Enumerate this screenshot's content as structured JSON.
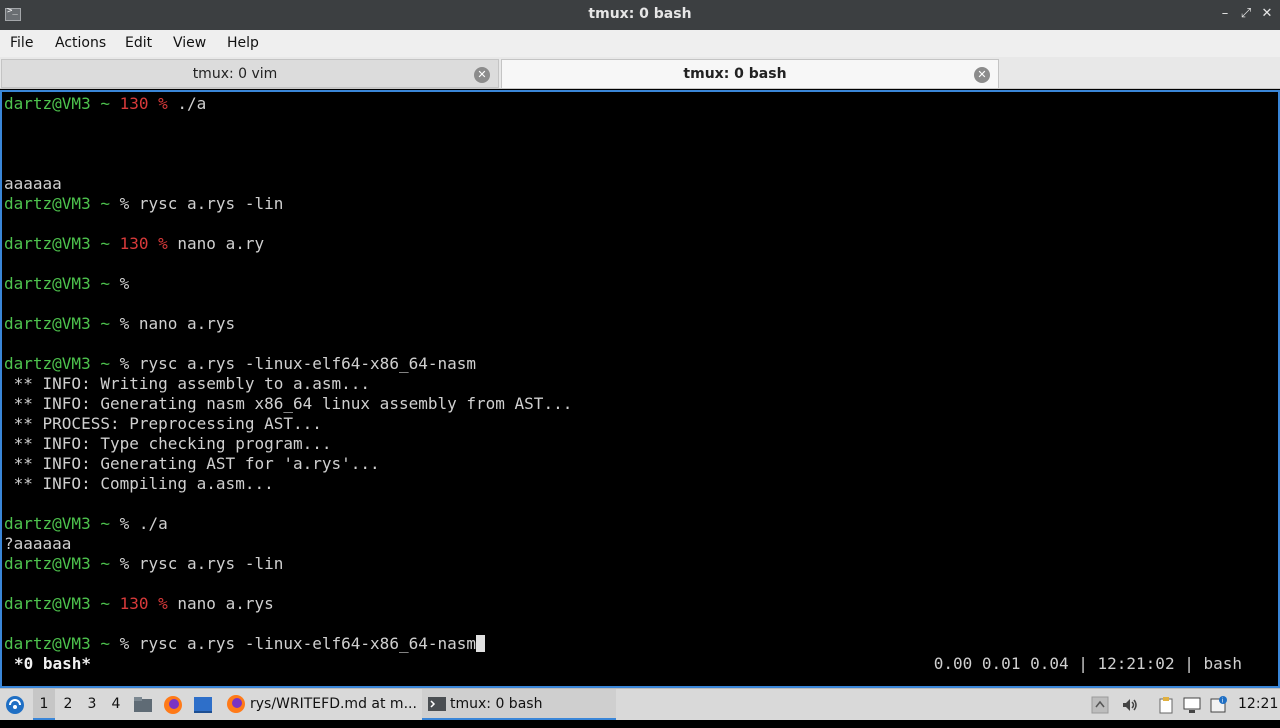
{
  "window": {
    "title": "tmux: 0 bash"
  },
  "menu": [
    "File",
    "Actions",
    "Edit",
    "View",
    "Help"
  ],
  "tabs": [
    {
      "label": "tmux: 0 vim",
      "active": false
    },
    {
      "label": "tmux: 0 bash",
      "active": true
    }
  ],
  "terminal": {
    "lines": [
      {
        "user": "dartz@VM3 ~ ",
        "code": "130",
        "prompt": " % ",
        "cmd": "./a"
      },
      {
        "text": ""
      },
      {
        "text": ""
      },
      {
        "text": ""
      },
      {
        "text": "aaaaaa"
      },
      {
        "user": "dartz@VM3 ~ ",
        "prompt": "% ",
        "cmd": "rysc a.rys -lin"
      },
      {
        "text": ""
      },
      {
        "user": "dartz@VM3 ~ ",
        "code": "130",
        "prompt": " % ",
        "cmd": "nano a.ry"
      },
      {
        "text": ""
      },
      {
        "user": "dartz@VM3 ~ ",
        "prompt": "% ",
        "cmd": ""
      },
      {
        "text": ""
      },
      {
        "user": "dartz@VM3 ~ ",
        "prompt": "% ",
        "cmd": "nano a.rys"
      },
      {
        "text": ""
      },
      {
        "user": "dartz@VM3 ~ ",
        "prompt": "% ",
        "cmd": "rysc a.rys -linux-elf64-x86_64-nasm"
      },
      {
        "text": " ** INFO: Writing assembly to a.asm..."
      },
      {
        "text": " ** INFO: Generating nasm x86_64 linux assembly from AST..."
      },
      {
        "text": " ** PROCESS: Preprocessing AST..."
      },
      {
        "text": " ** INFO: Type checking program..."
      },
      {
        "text": " ** INFO: Generating AST for 'a.rys'..."
      },
      {
        "text": " ** INFO: Compiling a.asm..."
      },
      {
        "text": ""
      },
      {
        "user": "dartz@VM3 ~ ",
        "prompt": "% ",
        "cmd": "./a"
      },
      {
        "text": "?aaaaaa"
      },
      {
        "user": "dartz@VM3 ~ ",
        "prompt": "% ",
        "cmd": "rysc a.rys -lin"
      },
      {
        "text": ""
      },
      {
        "user": "dartz@VM3 ~ ",
        "code": "130",
        "prompt": " % ",
        "cmd": "nano a.rys"
      },
      {
        "text": ""
      },
      {
        "user": "dartz@VM3 ~ ",
        "prompt": "% ",
        "cmd": "rysc a.rys -linux-elf64-x86_64-nasm",
        "cursor": true
      }
    ],
    "status_left": "*0 bash*",
    "status_right": "0.00 0.01 0.04 | 12:21:02 | bash"
  },
  "taskbar": {
    "workspaces": [
      "1",
      "2",
      "3",
      "4"
    ],
    "tasks": [
      {
        "label": "rys/WRITEFD.md at m...",
        "icon": "firefox-icon"
      },
      {
        "label": "tmux: 0 bash",
        "icon": "terminal-icon",
        "active": true
      }
    ],
    "clock": "12:21"
  },
  "colors": {
    "prompt_user": "#4ec44e",
    "exit_code": "#d83a3a",
    "accent": "#3a86d8"
  }
}
